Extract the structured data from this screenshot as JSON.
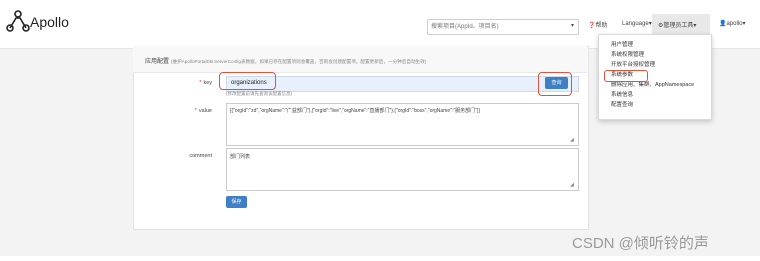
{
  "app": {
    "title": "Apollo"
  },
  "navbar": {
    "search_placeholder": "搜索项目(AppId、项目名)",
    "search_caret": "▾",
    "help": "帮助",
    "language": "Language",
    "admin_tools": "管理员工具",
    "user": "apollo",
    "caret": "▾",
    "colors": {
      "accent": "#3f7fc6",
      "highlight_box": "#e2533d"
    }
  },
  "admin_menu": {
    "items": [
      "用户管理",
      "系统权限管理",
      "开放平台授权管理",
      "系统参数",
      "删除应用、集群、AppNamespace",
      "系统信息",
      "配置查询"
    ],
    "selected": "系统参数"
  },
  "panel": {
    "title": "应用配置",
    "subtitle": "(维护ApolloPortalDB.ServerConfig表数据，如果已存在配置项则会覆盖，否则会创建配置项。配置更新后，一分钟后自动生效)",
    "key_label": "key",
    "key_value": "organizations",
    "key_hint": "(修改配置前请先查询该配置信息)",
    "query_button": "查询",
    "value_label": "value",
    "value_text": "[{\"orgId\":\"zd\",\"orgName\":\"广益部门\"},{\"orgId\":\"live\",\"orgName\":\"直播部门\"},{\"orgId\":\"boss\",\"orgName\":\"服务部门\"}]",
    "comment_label": "comment",
    "comment_text": "部门列表",
    "save_button": "保存",
    "required_mark": "*"
  },
  "watermark": "CSDN @倾听铃的声"
}
